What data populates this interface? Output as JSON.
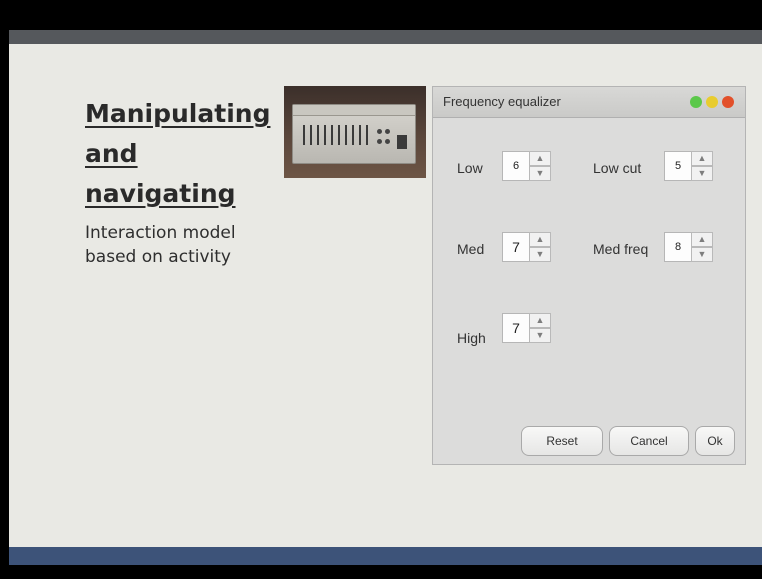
{
  "slide": {
    "title_lines": [
      "Manipulating",
      "and",
      "navigating"
    ],
    "subtitle_lines": [
      "Interaction model",
      "based on activity"
    ]
  },
  "window": {
    "title": "Frequency equalizer",
    "controls": {
      "low": {
        "label": "Low",
        "value": "6"
      },
      "low_cut": {
        "label": "Low cut",
        "value": "5"
      },
      "med": {
        "label": "Med",
        "value": "7"
      },
      "med_freq": {
        "label": "Med freq",
        "value": "8"
      },
      "high": {
        "label": "High",
        "value": "7"
      }
    },
    "buttons": {
      "reset": "Reset",
      "cancel": "Cancel",
      "ok": "Ok"
    },
    "traffic_lights": [
      "#5bc84a",
      "#e8cc2f",
      "#e2502a"
    ]
  },
  "icons": {
    "spinner_up": "▲",
    "spinner_down": "▼"
  }
}
